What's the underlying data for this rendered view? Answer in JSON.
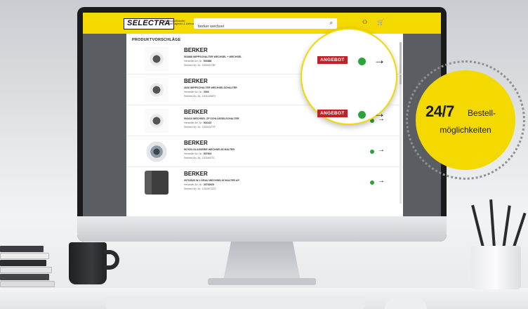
{
  "header": {
    "logo": "SELECTRA",
    "tagline": "Elektrogroßhändler Netzwerkagentur & Lieferant",
    "search_value": "berker wechsel",
    "icons": [
      "search-icon",
      "user-icon",
      "cart-icon"
    ]
  },
  "panel": {
    "title": "PRODUKTVORSCHLÄGE",
    "items": [
      {
        "brand": "BERKER",
        "desc": "503888 WIPPSCHALTER WECHSEL + WECHSEL",
        "mfr_label": "Hersteller Art.-Nr.:",
        "mfr_no": "503888",
        "sel_label": "Selectra Art.-Nr.:",
        "sel_no": "10003417BF"
      },
      {
        "brand": "BERKER",
        "desc": "3036 WIPPSCHALTER WECHSELSCHALTER",
        "mfr_label": "Hersteller Art.-Nr.:",
        "mfr_no": "3036",
        "sel_label": "Selectra Art.-Nr.:",
        "sel_no": "10031406F0"
      },
      {
        "brand": "BERKER",
        "desc": "503410 WECHSEL ZP SCHLÜSSELSCHALTER",
        "mfr_label": "Hersteller Art.-Nr.:",
        "mfr_no": "503410",
        "sel_label": "Selectra Art.-Nr.:",
        "sel_no": "10004107FF"
      },
      {
        "brand": "BERKER",
        "desc": "507603 GLASSERIE WECHSELSCHALTER",
        "mfr_label": "Hersteller Art.-Nr.:",
        "mfr_no": "507603",
        "sel_label": "Selectra Art.-Nr.:",
        "sel_no": "1023460TD"
      },
      {
        "brand": "BERKER",
        "desc": "30763525 W.1 GRAU WECHSELSCHALTER AP",
        "mfr_label": "Hersteller Art.-Nr.:",
        "mfr_no": "30763525",
        "sel_label": "Selectra Art.-Nr.:",
        "sel_no": "101530TZZ3"
      }
    ]
  },
  "callout": {
    "badge": "ANGEBOT",
    "status_color": "#2aa43a"
  },
  "promo": {
    "big": "24/7",
    "word1": "Bestell-",
    "word2": "möglichkeiten"
  },
  "colors": {
    "brand_yellow": "#f4d900",
    "badge_red": "#c42028",
    "available_green": "#2aa43a"
  }
}
